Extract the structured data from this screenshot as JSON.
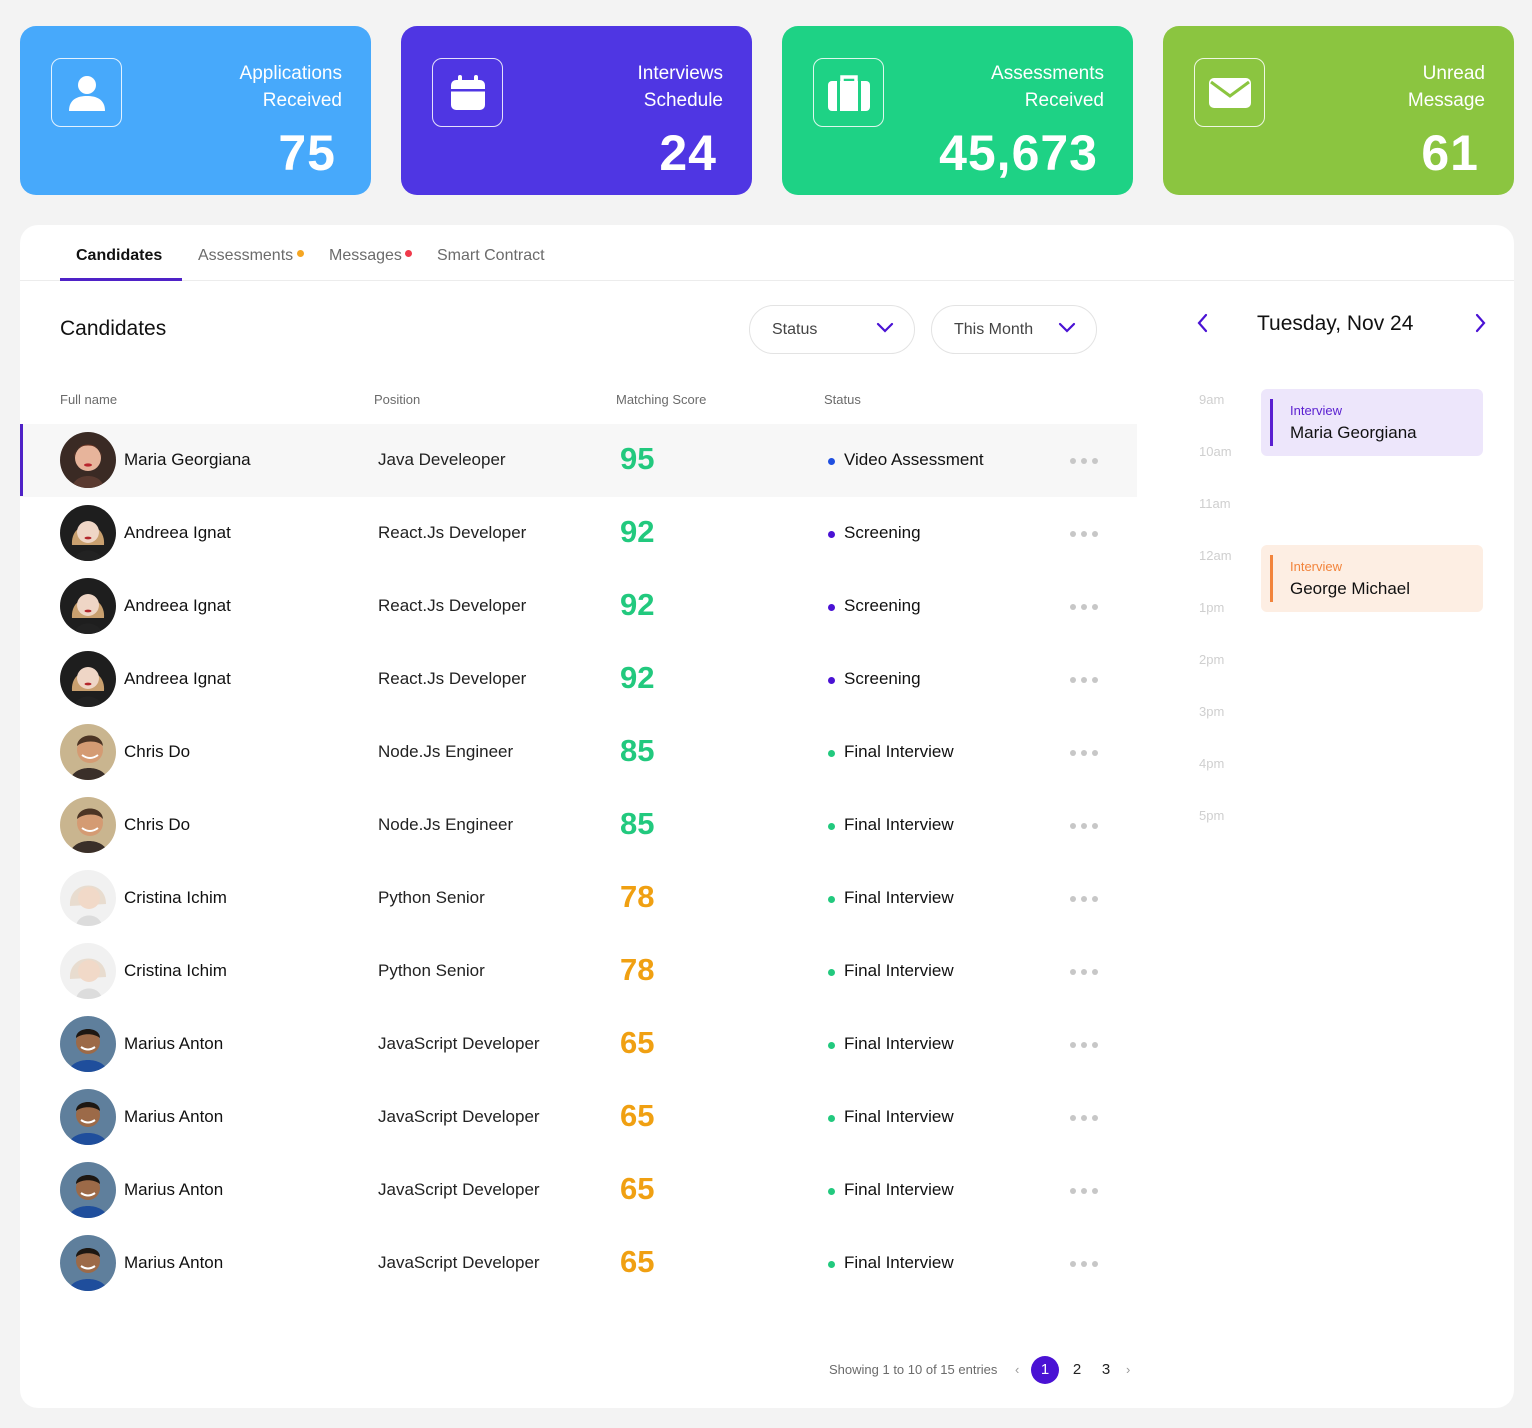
{
  "stats": [
    {
      "label_line1": "Applications",
      "label_line2": "Received",
      "value": "75",
      "color": "#47a9fb",
      "icon": "user-icon"
    },
    {
      "label_line1": "Interviews",
      "label_line2": "Schedule",
      "value": "24",
      "color": "#4f36e3",
      "icon": "calendar-icon"
    },
    {
      "label_line1": "Assessments",
      "label_line2": "Received",
      "value": "45,673",
      "color": "#1ed285",
      "icon": "briefcase-icon"
    },
    {
      "label_line1": "Unread",
      "label_line2": "Message",
      "value": "61",
      "color": "#8bc540",
      "icon": "mail-icon"
    }
  ],
  "tabs": [
    {
      "label": "Candidates",
      "active": true
    },
    {
      "label": "Assessments",
      "active": false,
      "dot": "#f5a623"
    },
    {
      "label": "Messages",
      "active": false,
      "dot": "#f03a4b"
    },
    {
      "label": "Smart Contract",
      "active": false
    }
  ],
  "section_title": "Candidates",
  "filters": {
    "status": "Status",
    "period": "This Month"
  },
  "columns": [
    "Full name",
    "Position",
    "Matching Score",
    "Status"
  ],
  "candidates": [
    {
      "name": "Maria Georgiana",
      "position": "Java Develeoper",
      "score": "95",
      "status": "Video Assessment",
      "avatar": "f1"
    },
    {
      "name": "Andreea Ignat",
      "position": "React.Js Developer",
      "score": "92",
      "status": "Screening",
      "avatar": "f2"
    },
    {
      "name": "Andreea Ignat",
      "position": "React.Js Developer",
      "score": "92",
      "status": "Screening",
      "avatar": "f2"
    },
    {
      "name": "Andreea Ignat",
      "position": "React.Js Developer",
      "score": "92",
      "status": "Screening",
      "avatar": "f2"
    },
    {
      "name": "Chris Do",
      "position": "Node.Js Engineer",
      "score": "85",
      "status": "Final Interview",
      "avatar": "m1"
    },
    {
      "name": "Chris Do",
      "position": "Node.Js Engineer",
      "score": "85",
      "status": "Final Interview",
      "avatar": "m1"
    },
    {
      "name": "Cristina Ichim",
      "position": "Python Senior",
      "score": "78",
      "status": "Final Interview",
      "avatar": "f3"
    },
    {
      "name": "Cristina Ichim",
      "position": "Python Senior",
      "score": "78",
      "status": "Final Interview",
      "avatar": "f3"
    },
    {
      "name": "Marius Anton",
      "position": "JavaScript Developer",
      "score": "65",
      "status": "Final Interview",
      "avatar": "m2"
    },
    {
      "name": "Marius Anton",
      "position": "JavaScript Developer",
      "score": "65",
      "status": "Final Interview",
      "avatar": "m2"
    },
    {
      "name": "Marius Anton",
      "position": "JavaScript Developer",
      "score": "65",
      "status": "Final Interview",
      "avatar": "m2"
    },
    {
      "name": "Marius Anton",
      "position": "JavaScript Developer",
      "score": "65",
      "status": "Final Interview",
      "avatar": "m2"
    }
  ],
  "score_colors": {
    "high": "#22c97e",
    "mid": "#f0a012"
  },
  "status_colors": {
    "Video Assessment": "#1f4fe0",
    "Screening": "#4a12d4",
    "Final Interview": "#22c97e"
  },
  "calendar": {
    "date": "Tuesday, Nov 24",
    "hours": [
      "9am",
      "10am",
      "11am",
      "12am",
      "1pm",
      "2pm",
      "3pm",
      "4pm",
      "5pm"
    ],
    "events": [
      {
        "type": "Interview",
        "name": "Maria Georgiana",
        "bg": "#ede6fb",
        "accent": "#5a1fd0"
      },
      {
        "type": "Interview",
        "name": "George Michael",
        "bg": "#fdeee3",
        "accent": "#f2843c"
      }
    ]
  },
  "pagination": {
    "summary": "Showing 1 to 10 of 15 entries",
    "pages": [
      "1",
      "2",
      "3"
    ],
    "current": "1"
  }
}
